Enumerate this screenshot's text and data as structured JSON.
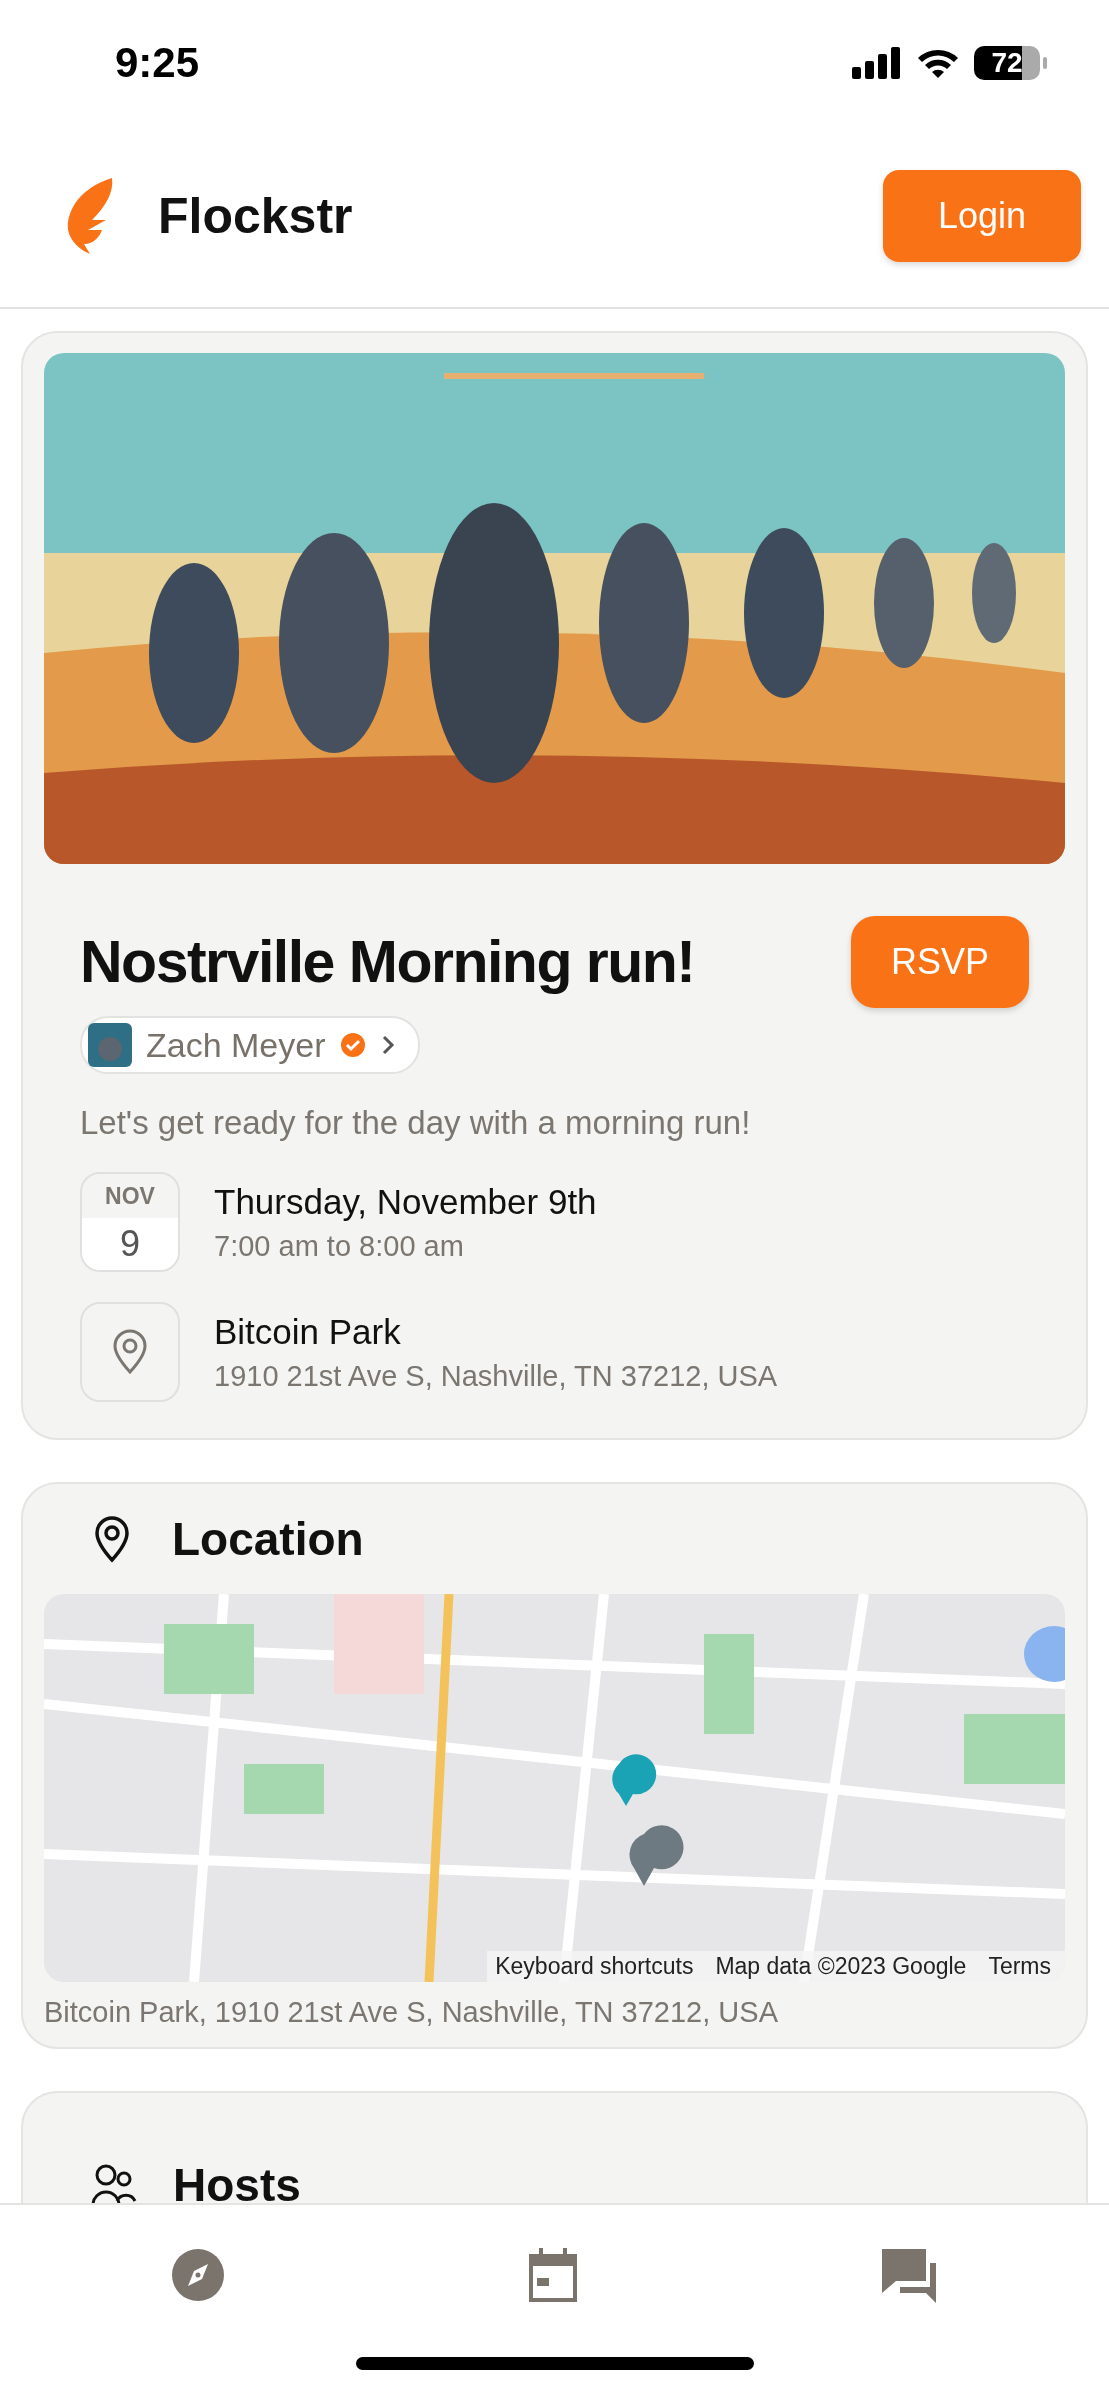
{
  "status_bar": {
    "time": "9:25",
    "battery": "72"
  },
  "header": {
    "app_name": "Flockstr",
    "login_button": "Login"
  },
  "event": {
    "title": "Nostrville Morning run!",
    "rsvp_button": "RSVP",
    "host": {
      "name": "Zach Meyer",
      "verified": true
    },
    "description": "Let's get ready for the day with a morning run!",
    "date": {
      "month": "NOV",
      "day": "9",
      "label": "Thursday, November 9th",
      "time": "7:00 am to 8:00 am"
    },
    "place": {
      "name": "Bitcoin Park",
      "address": "1910 21st Ave S, Nashville, TN 37212, USA"
    }
  },
  "location": {
    "title": "Location",
    "attribution": [
      "Keyboard shortcuts",
      "Map data ©2023 Google",
      "Terms"
    ],
    "address": "Bitcoin Park, 1910 21st Ave S, Nashville, TN 37212, USA"
  },
  "hosts": {
    "title": "Hosts"
  },
  "nav": [
    {
      "kind": "compass"
    },
    {
      "kind": "calendar"
    },
    {
      "kind": "chat"
    }
  ]
}
